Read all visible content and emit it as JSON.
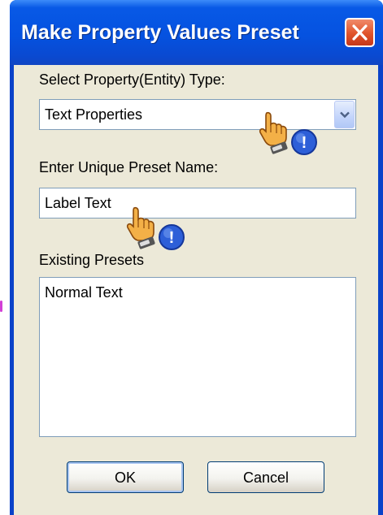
{
  "window": {
    "title": "Make Property Values Preset",
    "close_label": "×"
  },
  "form": {
    "type_label": "Select Property(Entity) Type:",
    "type_value": "Text Properties",
    "name_label": "Enter Unique Preset Name:",
    "name_value": "Label Text",
    "presets_label": "Existing Presets",
    "presets": [
      "Normal Text"
    ]
  },
  "buttons": {
    "ok_label": "OK",
    "cancel_label": "Cancel"
  },
  "cursors": {
    "icon": "hand-pointer-with-info-badge-icon",
    "badge_text": "!"
  },
  "colors": {
    "title_bar": "#0552e0",
    "dialog_face": "#ece9d8",
    "close_button": "#e0532a",
    "field_border": "#7f9db9"
  }
}
